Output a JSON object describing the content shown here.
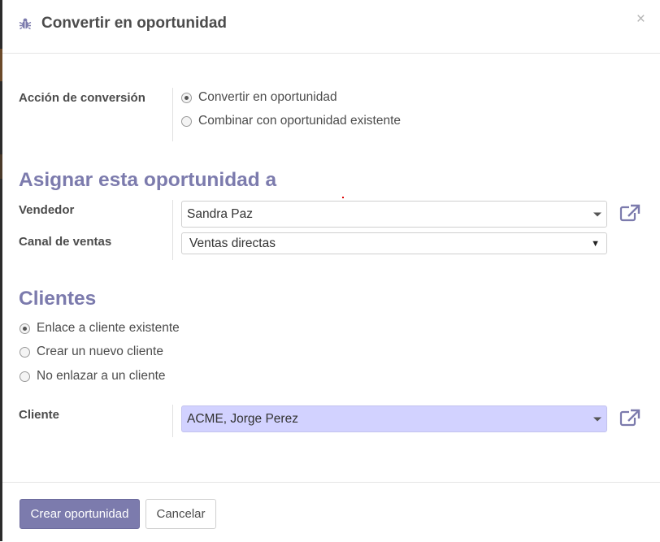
{
  "dialog": {
    "title": "Convertir en oportunidad",
    "close_label": "×"
  },
  "conversion": {
    "label": "Acción de conversión",
    "options": [
      {
        "label": "Convertir en oportunidad",
        "checked": true
      },
      {
        "label": "Combinar con oportunidad existente",
        "checked": false
      }
    ]
  },
  "assign": {
    "title": "Asignar esta oportunidad a",
    "salesperson_label": "Vendedor",
    "salesperson_value": "Sandra Paz",
    "sales_channel_label": "Canal de ventas",
    "sales_channel_value": "Ventas directas"
  },
  "customers": {
    "title": "Clientes",
    "options": [
      {
        "label": "Enlace a cliente existente",
        "checked": true
      },
      {
        "label": "Crear un nuevo cliente",
        "checked": false
      },
      {
        "label": "No enlazar a un cliente",
        "checked": false
      }
    ],
    "customer_label": "Cliente",
    "customer_value": "ACME, Jorge Perez"
  },
  "footer": {
    "primary_label": "Crear oportunidad",
    "cancel_label": "Cancelar"
  },
  "colors": {
    "accent": "#7c7bad",
    "highlight_field": "#d2d2ff",
    "text": "#4c4c4c"
  },
  "icons": {
    "header": "bug-icon",
    "external_link": "external-link-icon",
    "dropdown": "caret-down-icon"
  }
}
